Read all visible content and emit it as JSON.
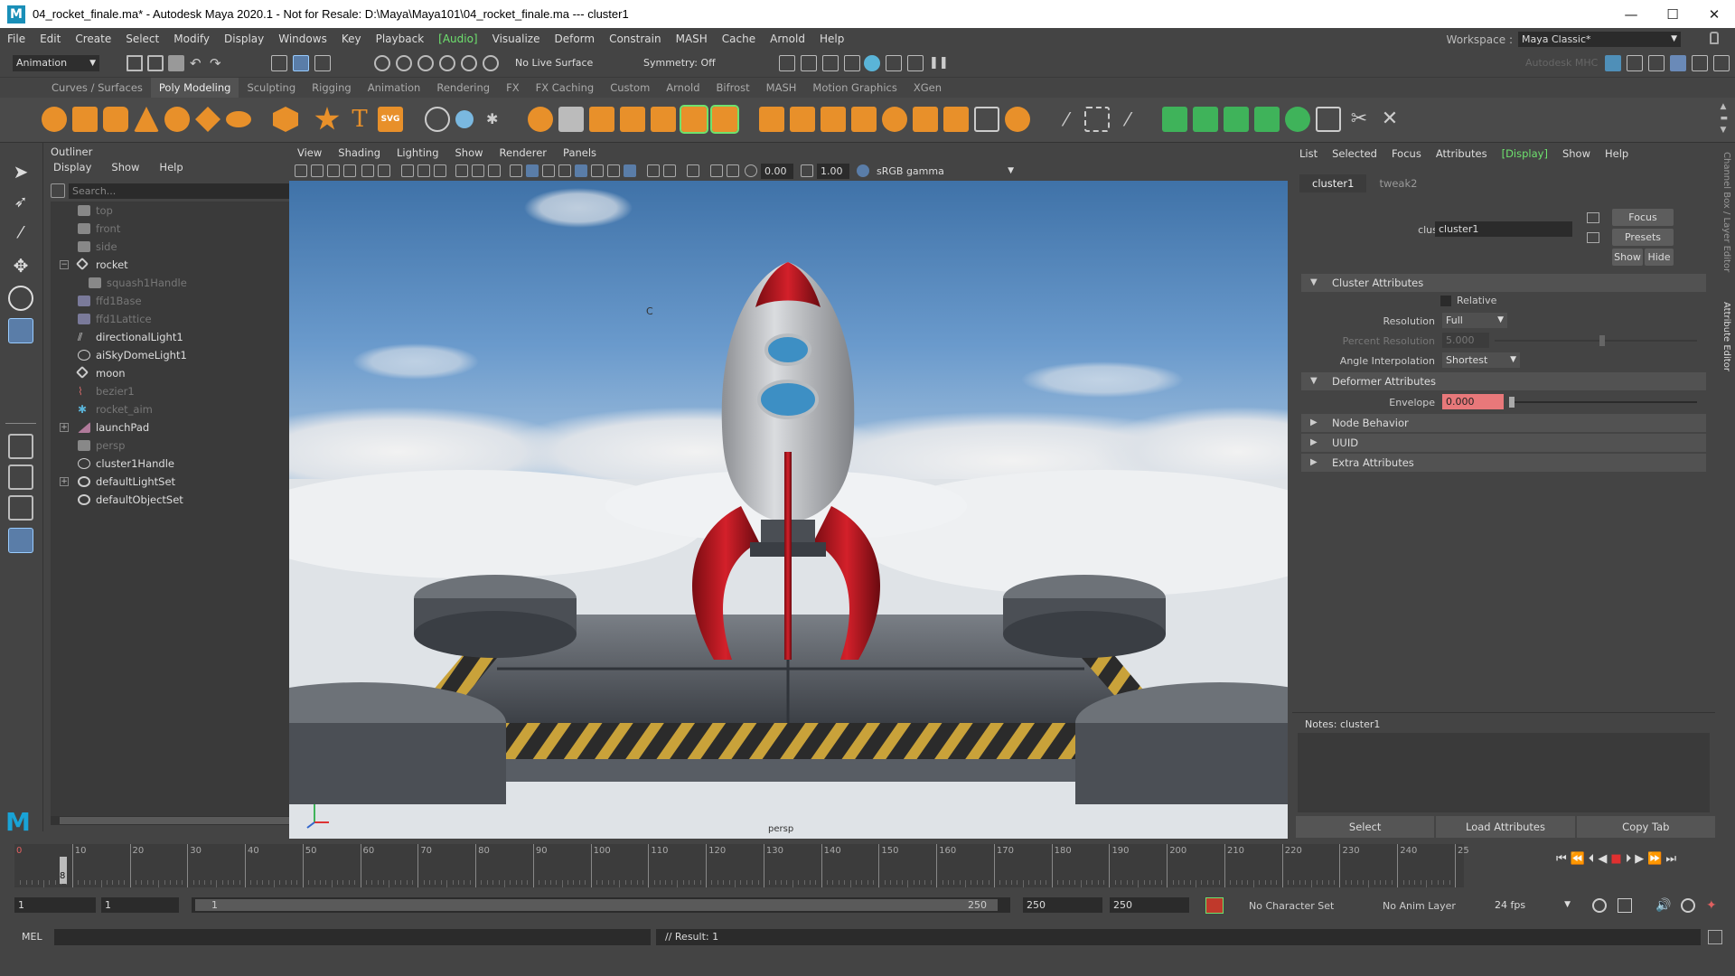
{
  "window": {
    "title": "04_rocket_finale.ma* - Autodesk Maya 2020.1 - Not for Resale: D:\\Maya\\Maya101\\04_rocket_finale.ma  ---  cluster1",
    "logo": "M",
    "minimize": "—",
    "maximize": "☐",
    "close": "✕"
  },
  "menubar": {
    "items": [
      "File",
      "Edit",
      "Create",
      "Select",
      "Modify",
      "Display",
      "Windows",
      "Key",
      "Playback",
      "[Audio]",
      "Visualize",
      "Deform",
      "Constrain",
      "MASH",
      "Cache",
      "Arnold",
      "Help"
    ],
    "workspace_label": "Workspace :",
    "workspace_value": "Maya Classic*"
  },
  "statusline": {
    "menuset": "Animation",
    "live_surface": "No Live Surface",
    "symmetry": "Symmetry: Off",
    "brand": "Autodesk MHC"
  },
  "shelf": {
    "tabs": [
      "Curves / Surfaces",
      "Poly Modeling",
      "Sculpting",
      "Rigging",
      "Animation",
      "Rendering",
      "FX",
      "FX Caching",
      "Custom",
      "Arnold",
      "Bifrost",
      "MASH",
      "Motion Graphics",
      "XGen"
    ],
    "active": "Poly Modeling",
    "text_icon": "T",
    "svg_icon": "SVG"
  },
  "outliner": {
    "title": "Outliner",
    "menu": [
      "Display",
      "Show",
      "Help"
    ],
    "search_placeholder": "Search...",
    "items": [
      {
        "label": "top",
        "dim": true
      },
      {
        "label": "front",
        "dim": true
      },
      {
        "label": "side",
        "dim": true
      },
      {
        "label": "rocket",
        "dim": false,
        "expander": "−"
      },
      {
        "label": "squash1Handle",
        "dim": true
      },
      {
        "label": "ffd1Base",
        "dim": true
      },
      {
        "label": "ffd1Lattice",
        "dim": true
      },
      {
        "label": "directionalLight1",
        "dim": false
      },
      {
        "label": "aiSkyDomeLight1",
        "dim": false
      },
      {
        "label": "moon",
        "dim": false
      },
      {
        "label": "bezier1",
        "dim": true
      },
      {
        "label": "rocket_aim",
        "dim": true
      },
      {
        "label": "launchPad",
        "dim": false,
        "expander": "+"
      },
      {
        "label": "persp",
        "dim": true
      },
      {
        "label": "cluster1Handle",
        "dim": false
      },
      {
        "label": "defaultLightSet",
        "dim": false,
        "expander": "+"
      },
      {
        "label": "defaultObjectSet",
        "dim": false
      }
    ]
  },
  "viewport": {
    "menu": [
      "View",
      "Shading",
      "Lighting",
      "Show",
      "Renderer",
      "Panels"
    ],
    "exposure": "0.00",
    "gamma": "1.00",
    "colorspace": "sRGB gamma",
    "camera_label": "persp",
    "center_marker": "C"
  },
  "attribute_editor": {
    "menu": [
      "List",
      "Selected",
      "Focus",
      "Attributes",
      "[Display]",
      "Show",
      "Help"
    ],
    "tabs": [
      "cluster1",
      "tweak2"
    ],
    "node_label": "cluster:",
    "node_value": "cluster1",
    "buttons": {
      "focus": "Focus",
      "presets": "Presets",
      "show": "Show",
      "hide": "Hide"
    },
    "sections": {
      "cluster": "Cluster Attributes",
      "deformer": "Deformer Attributes",
      "node": "Node Behavior",
      "uuid": "UUID",
      "extra": "Extra Attributes"
    },
    "relative": "Relative",
    "resolution_label": "Resolution",
    "resolution_value": "Full",
    "percent_label": "Percent Resolution",
    "percent_value": "5.000",
    "angle_label": "Angle Interpolation",
    "angle_value": "Shortest",
    "envelope_label": "Envelope",
    "envelope_value": "0.000",
    "notes": "Notes:  cluster1",
    "bottom": [
      "Select",
      "Load Attributes",
      "Copy Tab"
    ],
    "side_tabs": "Channel Box / Layer Editor",
    "side_tabs2": "Attribute Editor"
  },
  "timeline": {
    "ticks": [
      "10",
      "20",
      "30",
      "40",
      "50",
      "60",
      "70",
      "80",
      "90",
      "100",
      "110",
      "120",
      "130",
      "140",
      "150",
      "160",
      "170",
      "180",
      "190",
      "200",
      "210",
      "220",
      "230",
      "240",
      "25"
    ],
    "current_frame": "8",
    "start": "0"
  },
  "range": {
    "start": "1",
    "start2": "1",
    "slider_start": "1",
    "slider_end": "250",
    "end": "250",
    "end2": "250",
    "character_set": "No Character Set",
    "anim_layer": "No Anim Layer",
    "fps": "24 fps"
  },
  "command": {
    "lang": "MEL",
    "result": "// Result: 1"
  },
  "colors": {
    "accent_green": "#6ee26e",
    "envelope_red": "#e8787a",
    "maya_blue": "#1a8fb8"
  }
}
